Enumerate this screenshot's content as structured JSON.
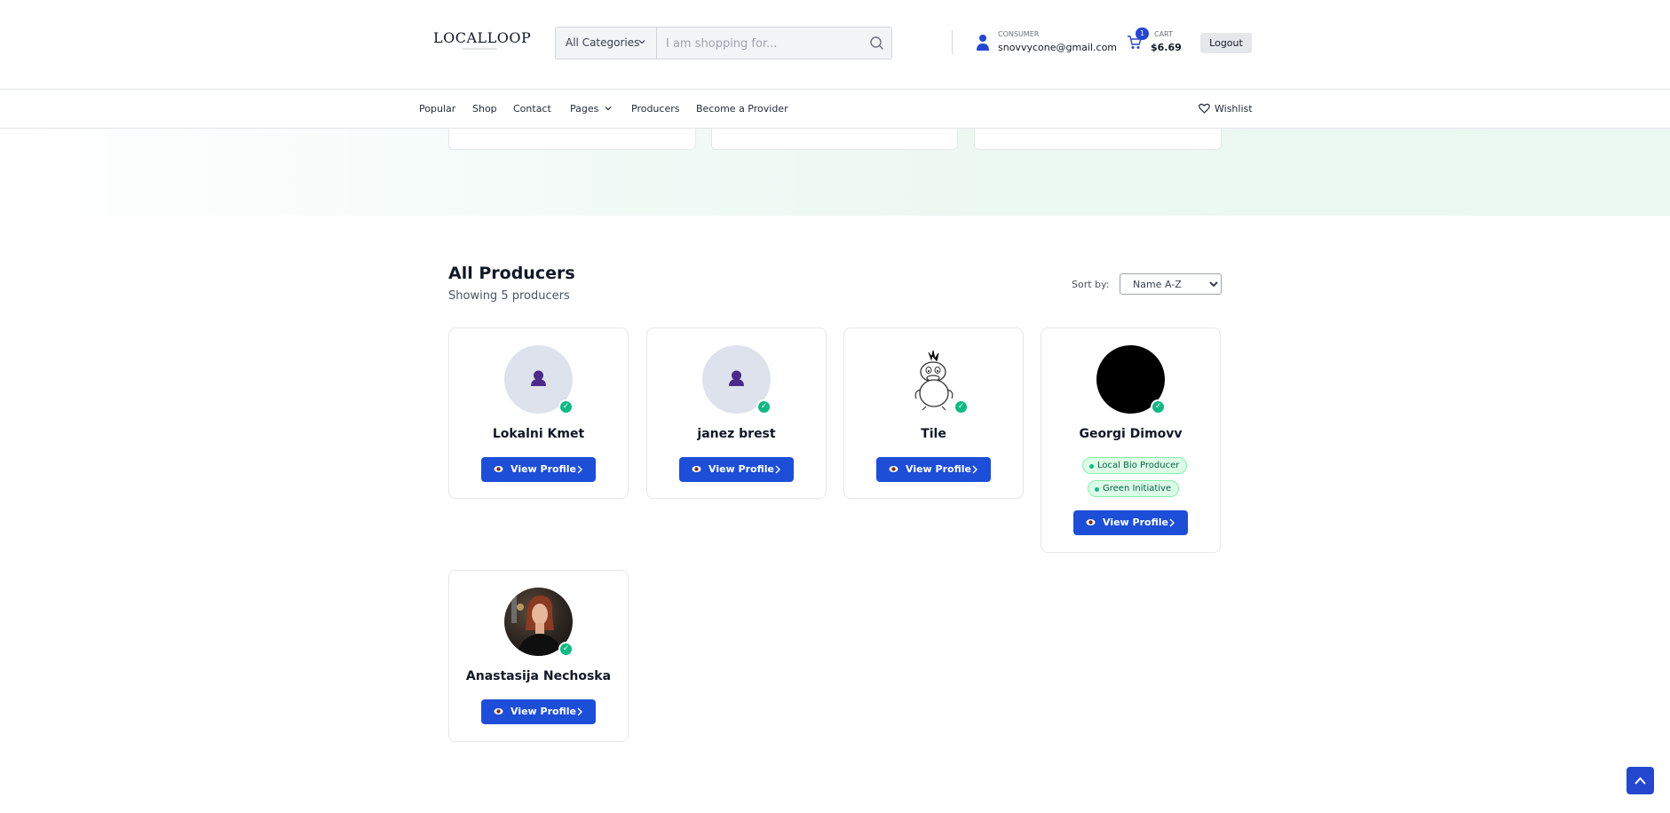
{
  "header": {
    "logo": "LOCALLOOP",
    "search": {
      "category": "All Categories",
      "placeholder": "I am shopping for..."
    },
    "account": {
      "role": "CONSUMER",
      "email": "snovvycone@gmail.com"
    },
    "cart": {
      "count": "1",
      "label": "CART",
      "total": "$6.69"
    },
    "logout": "Logout"
  },
  "nav": {
    "items": [
      "Popular",
      "Shop",
      "Contact",
      "Pages",
      "Producers",
      "Become a Provider"
    ],
    "wishlist": "Wishlist"
  },
  "section": {
    "title": "All Producers",
    "subtitle": "Showing 5 producers",
    "sort_label": "Sort by:",
    "sort_value": "Name A-Z"
  },
  "producers": [
    {
      "name": "Lokalni Kmet",
      "button": "View Profile",
      "tags": []
    },
    {
      "name": "janez brest",
      "button": "View Profile",
      "tags": []
    },
    {
      "name": "Tile",
      "button": "View Profile",
      "tags": []
    },
    {
      "name": "Georgi Dimovv",
      "button": "View Profile",
      "tags": [
        "Local Bio Producer",
        "Green Initiative"
      ]
    },
    {
      "name": "Anastasija Nechoska",
      "button": "View Profile",
      "tags": []
    }
  ],
  "colors": {
    "primary": "#1d4ed8",
    "verified": "#10b981",
    "tag_bg": "#dcfce7"
  },
  "icons": [
    "search-icon",
    "chevron-down-icon",
    "user-icon",
    "cart-icon",
    "heart-icon",
    "eye-icon",
    "chevron-right-icon",
    "verified-check-icon",
    "arrow-up-icon"
  ]
}
